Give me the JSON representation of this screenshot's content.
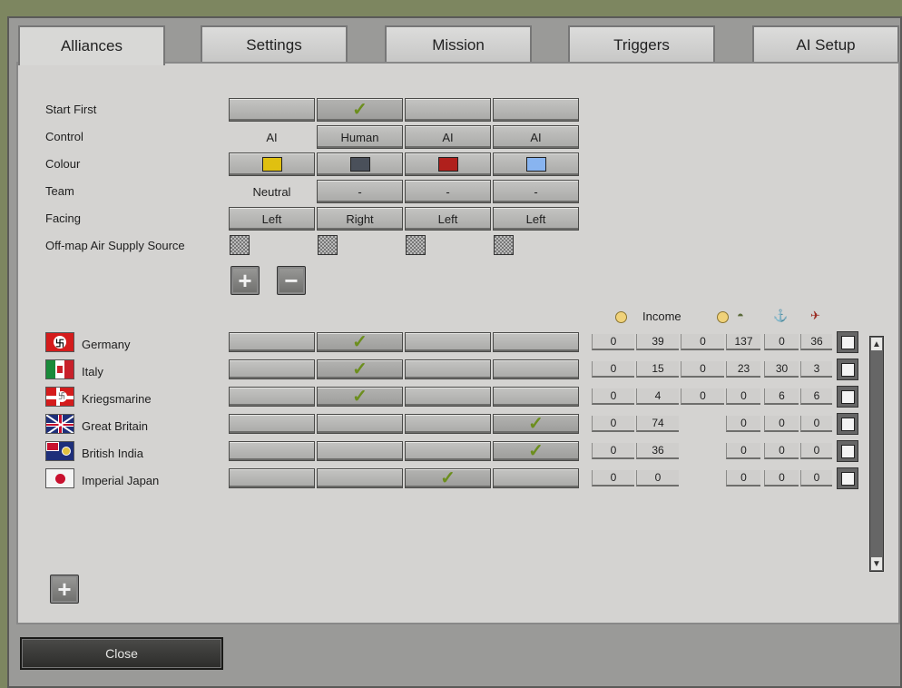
{
  "tabs": [
    "Alliances",
    "Settings",
    "Mission",
    "Triggers",
    "AI Setup"
  ],
  "settings": {
    "labels": [
      "Start First",
      "Control",
      "Colour",
      "Team",
      "Facing",
      "Off-map Air Supply Source"
    ],
    "control": [
      "AI",
      "Human",
      "AI",
      "AI"
    ],
    "colours": [
      "#e0c010",
      "#4a505a",
      "#b0201c",
      "#88b4f0"
    ],
    "team": [
      "Neutral",
      "-",
      "-",
      "-"
    ],
    "facing": [
      "Left",
      "Right",
      "Left",
      "Left"
    ],
    "check_mark": "✓",
    "start_first_selected": 1
  },
  "add_button": "+",
  "remove_button": "−",
  "header": {
    "income": "Income"
  },
  "nations": [
    {
      "name": "Germany",
      "flag": "germany-flag",
      "selected": 1,
      "values": [
        "0",
        "39",
        "0",
        "137",
        "0",
        "36"
      ]
    },
    {
      "name": "Italy",
      "flag": "italy-flag",
      "selected": 1,
      "values": [
        "0",
        "15",
        "0",
        "23",
        "30",
        "3"
      ]
    },
    {
      "name": "Kriegsmarine",
      "flag": "kriegsmarine-flag",
      "selected": 1,
      "values": [
        "0",
        "4",
        "0",
        "0",
        "6",
        "6"
      ]
    },
    {
      "name": "Great Britain",
      "flag": "uk-flag",
      "selected": 3,
      "values": [
        "0",
        "74",
        "",
        "0",
        "0",
        "0"
      ]
    },
    {
      "name": "British India",
      "flag": "british-india-flag",
      "selected": 3,
      "values": [
        "0",
        "36",
        "",
        "0",
        "0",
        "0"
      ]
    },
    {
      "name": "Imperial Japan",
      "flag": "japan-flag",
      "selected": 2,
      "values": [
        "0",
        "0",
        "",
        "0",
        "0",
        "0"
      ]
    }
  ],
  "close_label": "Close"
}
